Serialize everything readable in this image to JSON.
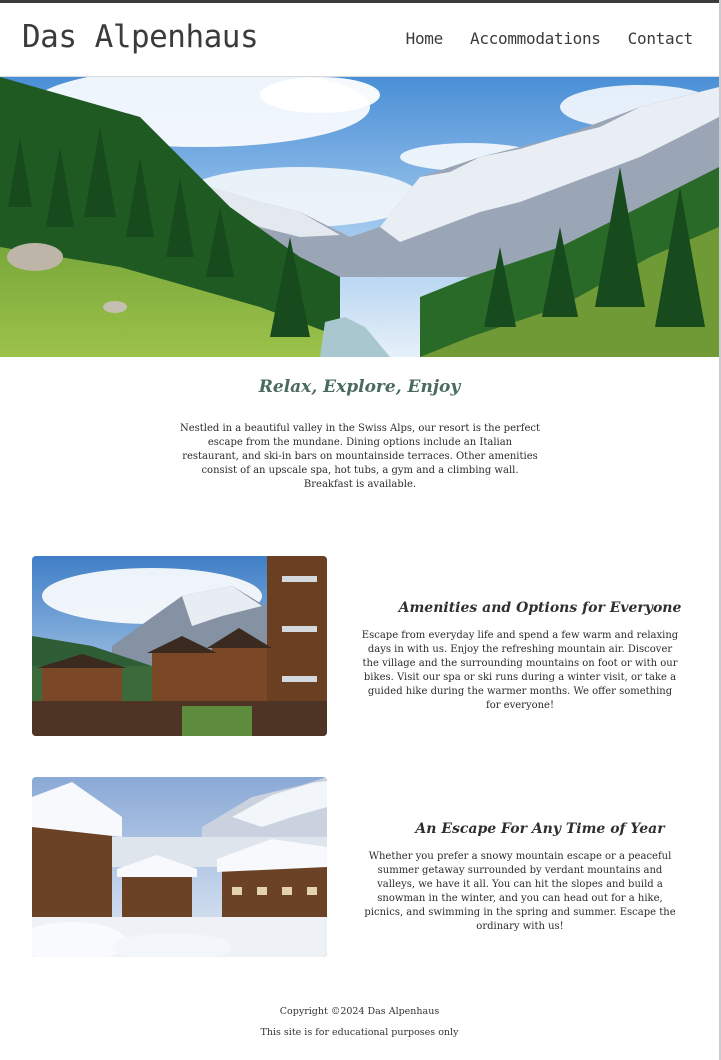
{
  "site": {
    "logo": "Das Alpenhaus",
    "nav": [
      "Home",
      "Accommodations",
      "Contact"
    ]
  },
  "intro": {
    "title": "Relax, Explore, Enjoy",
    "text": "Nestled in a beautiful valley in the Swiss Alps, our resort is the perfect escape from the mundane. Dining options include an Italian restaurant, and ski-in bars on mountainside terraces. Other amenities consist of an upscale spa, hot tubs, a gym and a climbing wall. Breakfast is available."
  },
  "sections": [
    {
      "title": "Amenities and Options for Everyone",
      "text": "Escape from everyday life and spend a few warm and relaxing days in with us. Enjoy the refreshing mountain air. Discover the village and the surrounding mountains on foot or with our bikes. Visit our spa or ski runs during a winter visit, or take a guided hike during the warmer months. We offer something for everyone!"
    },
    {
      "title": "An Escape For Any Time of Year",
      "text": "Whether you prefer a snowy mountain escape or a peaceful summer getaway surrounded by verdant mountains and valleys, we have it all. You can hit the slopes and build a snowman in the winter, and you can head out for a hike, picnics, and swimming in the spring and summer. Escape the ordinary with us!"
    }
  ],
  "footer": {
    "copyright": "Copyright ©2024 Das Alpenhaus",
    "note": "This site is for educational purposes only"
  },
  "colors": {
    "accent_green": "#4a6b5e",
    "text": "#2b2b2b",
    "header_text": "#3b3b3b"
  }
}
